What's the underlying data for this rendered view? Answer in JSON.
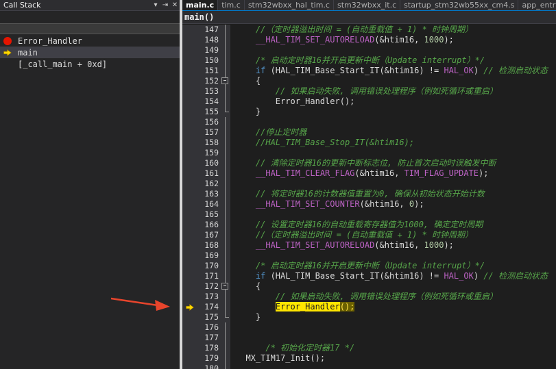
{
  "call_stack": {
    "title": "Call Stack",
    "header_buttons": [
      "▾",
      "⇥",
      "✕"
    ],
    "frames": [
      {
        "marker": "breakpoint",
        "text": "Error_Handler",
        "selected": false
      },
      {
        "marker": "current",
        "text": "main",
        "selected": true
      },
      {
        "marker": "none",
        "text": "[_call_main + 0xd]",
        "selected": false
      }
    ]
  },
  "editor": {
    "tabs": [
      {
        "label": "main.c",
        "active": true
      },
      {
        "label": "tim.c",
        "active": false
      },
      {
        "label": "stm32wbxx_hal_tim.c",
        "active": false
      },
      {
        "label": "stm32wbxx_it.c",
        "active": false
      },
      {
        "label": "startup_stm32wb55xx_cm4.s",
        "active": false
      },
      {
        "label": "app_entry.c",
        "active": false
      }
    ],
    "function_scope": "main()",
    "lines": [
      {
        "num": "147",
        "fold": "line",
        "gutter": "",
        "segs": [
          [
            "c",
            "    //（定时器溢出时间 = (自动重载值 + 1) * 时钟周期）"
          ]
        ]
      },
      {
        "num": "148",
        "fold": "line",
        "gutter": "",
        "segs": [
          [
            "m",
            "    __HAL_TIM_SET_AUTORELOAD"
          ],
          [
            "d",
            "(&htim16, "
          ],
          [
            "n",
            "1000"
          ],
          [
            "d",
            ");"
          ]
        ]
      },
      {
        "num": "149",
        "fold": "line",
        "gutter": "",
        "segs": []
      },
      {
        "num": "150",
        "fold": "line",
        "gutter": "",
        "segs": [
          [
            "c",
            "    /* 启动定时器16并开启更新中断（Update interrupt）*/"
          ]
        ]
      },
      {
        "num": "151",
        "fold": "line",
        "gutter": "",
        "segs": [
          [
            "k",
            "    if"
          ],
          [
            "d",
            " (HAL_TIM_Base_Start_IT(&htim16) != "
          ],
          [
            "m",
            "HAL_OK"
          ],
          [
            "d",
            ") "
          ],
          [
            "c",
            "// 检测启动状态"
          ]
        ]
      },
      {
        "num": "152",
        "fold": "box",
        "gutter": "",
        "segs": [
          [
            "d",
            "    {"
          ]
        ]
      },
      {
        "num": "153",
        "fold": "line",
        "gutter": "",
        "segs": [
          [
            "c",
            "        // 如果启动失败, 调用错误处理程序（例如死循环或重启）"
          ]
        ]
      },
      {
        "num": "154",
        "fold": "line",
        "gutter": "",
        "segs": [
          [
            "d",
            "        Error_Handler();"
          ]
        ]
      },
      {
        "num": "155",
        "fold": "end",
        "gutter": "",
        "segs": [
          [
            "d",
            "    }"
          ]
        ]
      },
      {
        "num": "156",
        "fold": "line",
        "gutter": "",
        "segs": []
      },
      {
        "num": "157",
        "fold": "line",
        "gutter": "",
        "segs": [
          [
            "c",
            "    //停止定时器"
          ]
        ]
      },
      {
        "num": "158",
        "fold": "line",
        "gutter": "",
        "segs": [
          [
            "c",
            "    //HAL_TIM_Base_Stop_IT(&htim16);"
          ]
        ]
      },
      {
        "num": "159",
        "fold": "line",
        "gutter": "",
        "segs": []
      },
      {
        "num": "160",
        "fold": "line",
        "gutter": "",
        "segs": [
          [
            "c",
            "    // 清除定时器16的更新中断标志位, 防止首次启动时误触发中断"
          ]
        ]
      },
      {
        "num": "161",
        "fold": "line",
        "gutter": "",
        "segs": [
          [
            "m",
            "    __HAL_TIM_CLEAR_FLAG"
          ],
          [
            "d",
            "(&htim16, "
          ],
          [
            "m",
            "TIM_FLAG_UPDATE"
          ],
          [
            "d",
            ");"
          ]
        ]
      },
      {
        "num": "162",
        "fold": "line",
        "gutter": "",
        "segs": []
      },
      {
        "num": "163",
        "fold": "line",
        "gutter": "",
        "segs": [
          [
            "c",
            "    // 将定时器16的计数器值重置为0, 确保从初始状态开始计数"
          ]
        ]
      },
      {
        "num": "164",
        "fold": "line",
        "gutter": "",
        "segs": [
          [
            "m",
            "    __HAL_TIM_SET_COUNTER"
          ],
          [
            "d",
            "(&htim16, "
          ],
          [
            "n",
            "0"
          ],
          [
            "d",
            ");"
          ]
        ]
      },
      {
        "num": "165",
        "fold": "line",
        "gutter": "",
        "segs": []
      },
      {
        "num": "166",
        "fold": "line",
        "gutter": "",
        "segs": [
          [
            "c",
            "    // 设置定时器16的自动重载寄存器值为1000, 确定定时周期"
          ]
        ]
      },
      {
        "num": "167",
        "fold": "line",
        "gutter": "",
        "segs": [
          [
            "c",
            "    //（定时器溢出时间 = (自动重载值 + 1) * 时钟周期）"
          ]
        ]
      },
      {
        "num": "168",
        "fold": "line",
        "gutter": "",
        "segs": [
          [
            "m",
            "    __HAL_TIM_SET_AUTORELOAD"
          ],
          [
            "d",
            "(&htim16, "
          ],
          [
            "n",
            "1000"
          ],
          [
            "d",
            ");"
          ]
        ]
      },
      {
        "num": "169",
        "fold": "line",
        "gutter": "",
        "segs": []
      },
      {
        "num": "170",
        "fold": "line",
        "gutter": "",
        "segs": [
          [
            "c",
            "    /* 启动定时器16并开启更新中断（Update interrupt）*/"
          ]
        ]
      },
      {
        "num": "171",
        "fold": "line",
        "gutter": "",
        "segs": [
          [
            "k",
            "    if"
          ],
          [
            "d",
            " (HAL_TIM_Base_Start_IT(&htim16) != "
          ],
          [
            "m",
            "HAL_OK"
          ],
          [
            "d",
            ") "
          ],
          [
            "c",
            "// 检测启动状态"
          ]
        ]
      },
      {
        "num": "172",
        "fold": "box",
        "gutter": "",
        "segs": [
          [
            "d",
            "    {"
          ]
        ]
      },
      {
        "num": "173",
        "fold": "line",
        "gutter": "",
        "segs": [
          [
            "c",
            "        // 如果启动失败, 调用错误处理程序（例如死循环或重启）"
          ]
        ]
      },
      {
        "num": "174",
        "fold": "line",
        "gutter": "current",
        "segs": [
          [
            "d",
            "        "
          ],
          [
            "cur",
            "Error_Handler"
          ],
          [
            "curt",
            "();"
          ]
        ]
      },
      {
        "num": "175",
        "fold": "end",
        "gutter": "",
        "segs": [
          [
            "d",
            "    }"
          ]
        ]
      },
      {
        "num": "176",
        "fold": "line",
        "gutter": "",
        "segs": []
      },
      {
        "num": "177",
        "fold": "line",
        "gutter": "",
        "segs": []
      },
      {
        "num": "178",
        "fold": "line",
        "gutter": "",
        "segs": [
          [
            "c",
            "      /* 初始化定时器17 */"
          ]
        ]
      },
      {
        "num": "179",
        "fold": "line",
        "gutter": "",
        "segs": [
          [
            "d",
            "  MX_TIM17_Init();"
          ]
        ]
      },
      {
        "num": "180",
        "fold": "line",
        "gutter": "",
        "segs": []
      }
    ]
  },
  "colors": {
    "breakpoint": "#e51400",
    "current_arrow": "#ffd700",
    "annotation_arrow": "#e8452c"
  }
}
